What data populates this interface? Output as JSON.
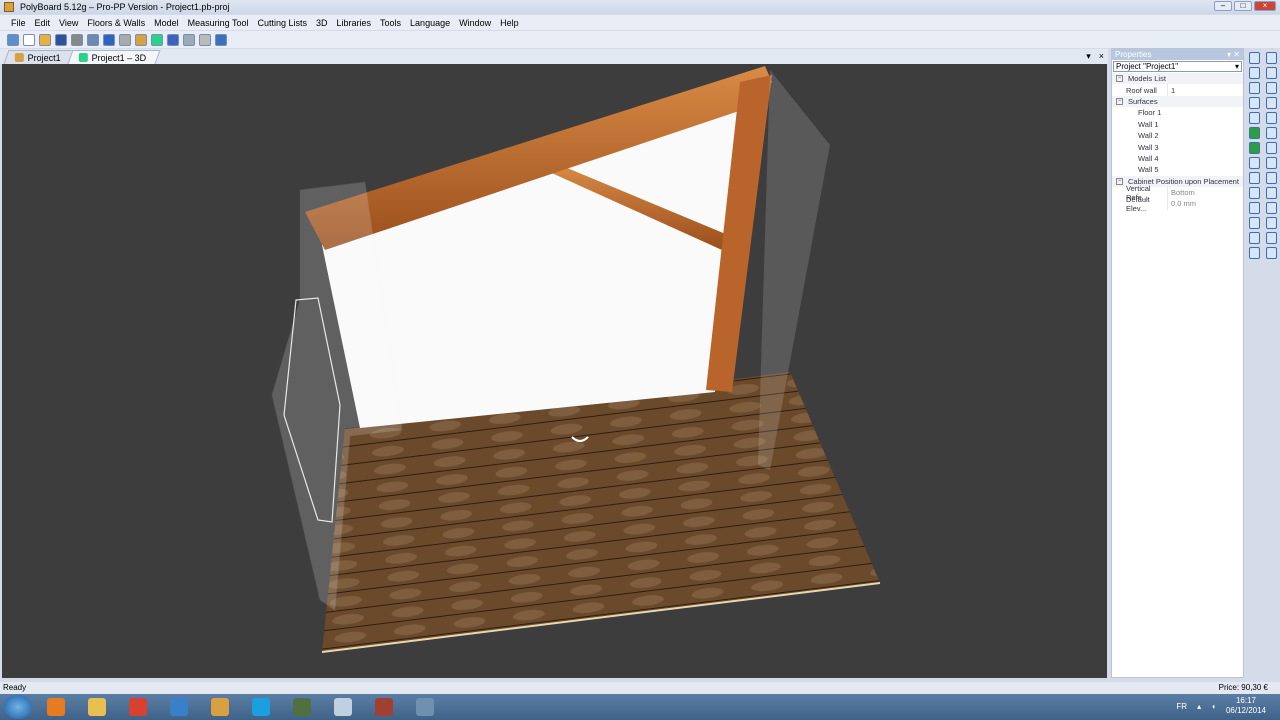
{
  "window": {
    "title": "PolyBoard 5.12g – Pro-PP Version - Project1.pb-proj"
  },
  "menu": [
    "File",
    "Edit",
    "View",
    "Floors & Walls",
    "Model",
    "Measuring Tool",
    "Cutting Lists",
    "3D",
    "Libraries",
    "Tools",
    "Language",
    "Window",
    "Help"
  ],
  "toolbar": {
    "icons": [
      "new-project-icon",
      "new-icon",
      "open-icon",
      "save-icon",
      "print-icon",
      "print-preview-icon",
      "undo-icon",
      "redo-icon",
      "properties-icon",
      "3d-box-icon",
      "3d-view-icon",
      "wireframe-icon",
      "cut-icon",
      "info-icon"
    ]
  },
  "tabs": [
    {
      "label": "Project1",
      "active": false
    },
    {
      "label": "Project1 – 3D",
      "active": true
    }
  ],
  "properties": {
    "title": "Properties",
    "selector": "Project \"Project1\"",
    "models_list": "Models List",
    "roof_wall_key": "Roof wall",
    "roof_wall_value": "1",
    "surfaces": "Surfaces",
    "surface_items": [
      "Floor 1",
      "Wall 1",
      "Wall 2",
      "Wall 3",
      "Wall 4",
      "Wall 5"
    ],
    "cabinet": "Cabinet Position upon Placement",
    "vertical_key": "Vertical Refe...",
    "vertical_value": "Bottom",
    "elev_key": "Default Elev...",
    "elev_value": "0.0 mm"
  },
  "status": {
    "text": "Ready",
    "price": "Price: 90,30 €"
  },
  "taskbar": {
    "lang": "FR",
    "time": "16:17",
    "date": "06/12/2014"
  },
  "colors": {
    "viewport": "#3d3d3d",
    "wood_beam": "#b8642a",
    "floor": "#6b4a2c"
  }
}
